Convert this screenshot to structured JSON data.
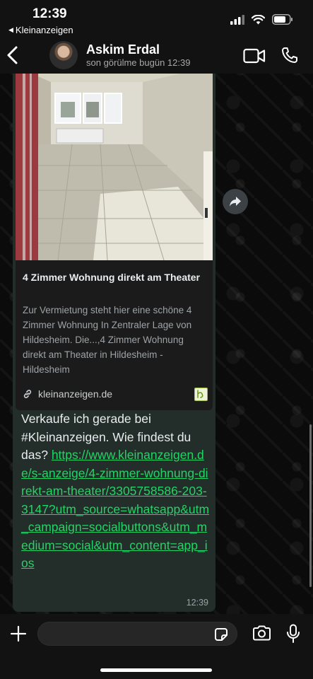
{
  "status_bar": {
    "time": "12:39",
    "back_app_label": "Kleinanzeigen"
  },
  "header": {
    "contact_name": "Askim Erdal",
    "contact_status": "son görülme bugün 12:39"
  },
  "link_preview": {
    "title": "4 Zimmer Wohnung direkt am Theater",
    "description": "Zur Vermietung steht hier eine schöne 4 Zimmer Wohnung In Zentraler Lage von Hildesheim. Die...,4 Zimmer Wohnung direkt am Theater in Hildesheim - Hildesheim",
    "domain": "kleinanzeigen.de"
  },
  "message": {
    "text": "Verkaufe ich gerade bei #Kleinanzeigen. Wie findest du das?",
    "link": "https://www.kleinanzeigen.de/s-anzeige/4-zimmer-wohnung-direkt-am-theater/3305758586-203-3147?utm_source=whatsapp&utm_campaign=socialbuttons&utm_medium=social&utm_content=app_ios",
    "time": "12:39"
  },
  "composer": {
    "input_value": ""
  },
  "colors": {
    "link_green": "#25d366",
    "bubble_bg": "#232d29",
    "header_bg": "#121212"
  },
  "icons": [
    "chevron-left-icon",
    "video-call-icon",
    "phone-icon",
    "forward-icon",
    "link-icon",
    "plus-icon",
    "sticker-icon",
    "camera-icon",
    "microphone-icon",
    "signal-icon",
    "wifi-icon",
    "battery-icon"
  ]
}
